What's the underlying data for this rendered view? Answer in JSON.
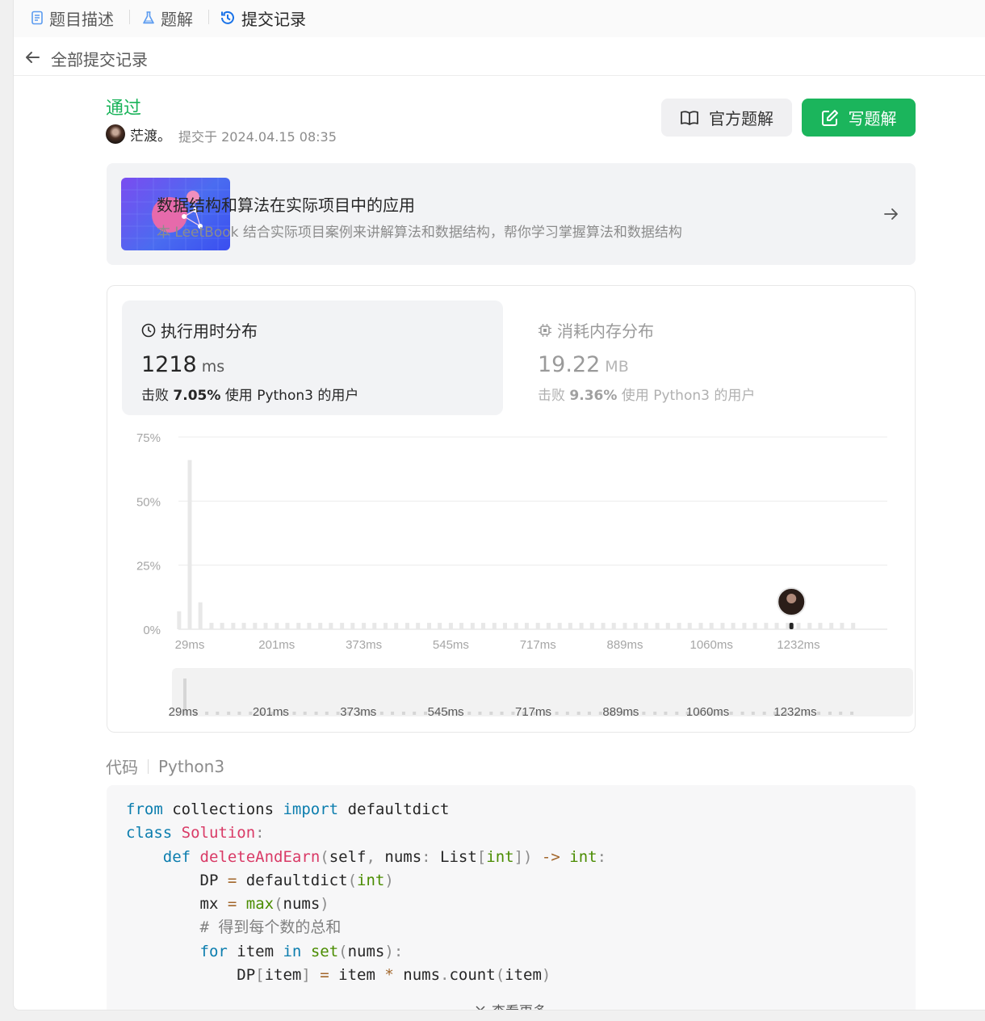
{
  "tabs": [
    {
      "label": "题目描述",
      "icon": "document-icon"
    },
    {
      "label": "题解",
      "icon": "flask-icon"
    },
    {
      "label": "提交记录",
      "icon": "history-icon",
      "active": true
    }
  ],
  "header": {
    "back_label": "全部提交记录"
  },
  "submission": {
    "status": "通过",
    "author": "茫渡。",
    "submitted": "提交于 2024.04.15 08:35",
    "official_button": "官方题解",
    "write_button": "写题解"
  },
  "banner": {
    "title": "数据结构和算法在实际项目中的应用",
    "desc": "本 LeetBook 结合实际项目案例来讲解算法和数据结构，帮你学习掌握算法和数据结构"
  },
  "runtime": {
    "label": "执行用时分布",
    "value": "1218",
    "unit": "ms",
    "beat_prefix": "击败",
    "beat_pct": "7.05%",
    "beat_suffix": "使用 Python3 的用户"
  },
  "memory": {
    "label": "消耗内存分布",
    "value": "19.22",
    "unit": "MB",
    "beat_prefix": "击败",
    "beat_pct": "9.36%",
    "beat_suffix": "使用 Python3 的用户"
  },
  "chart_data": {
    "type": "bar",
    "title": "",
    "xlabel": "",
    "ylabel": "",
    "y_ticks": [
      "75%",
      "50%",
      "25%",
      "0%"
    ],
    "ylim": [
      0,
      75
    ],
    "x_ticks": [
      "29ms",
      "201ms",
      "373ms",
      "545ms",
      "717ms",
      "889ms",
      "1060ms",
      "1232ms"
    ],
    "categories_ms": [
      8,
      29,
      50,
      72,
      93,
      115,
      136,
      158,
      179,
      201,
      222,
      244,
      265,
      287,
      308,
      330,
      351,
      373,
      394,
      416,
      437,
      459,
      480,
      502,
      523,
      545,
      566,
      588,
      609,
      631,
      652,
      674,
      695,
      717,
      738,
      760,
      781,
      803,
      824,
      846,
      867,
      889,
      910,
      931,
      953,
      974,
      996,
      1017,
      1039,
      1060,
      1082,
      1103,
      1125,
      1146,
      1168,
      1189,
      1211,
      1232,
      1254,
      1275,
      1297,
      1318,
      1340
    ],
    "values": [
      7,
      66,
      10.5,
      2.5,
      2.5,
      2.5,
      2.5,
      2.5,
      2.5,
      2.5,
      2.5,
      2.5,
      2.5,
      2.5,
      2.5,
      2.5,
      2.5,
      2.5,
      2.5,
      2.5,
      2.5,
      2.5,
      2.5,
      2.5,
      2.5,
      2.5,
      2.5,
      2.5,
      2.5,
      2.5,
      2.5,
      2.5,
      2.5,
      2.5,
      2.5,
      2.5,
      2.5,
      2.5,
      2.5,
      2.5,
      2.5,
      2.5,
      2.5,
      2.5,
      2.5,
      2.5,
      2.5,
      2.5,
      2.5,
      2.5,
      2.5,
      2.5,
      2.5,
      2.5,
      2.5,
      2.5,
      2.5,
      2.5,
      2.5,
      2.5,
      2.5,
      2.5,
      2.5
    ],
    "highlight_ms": 1218,
    "grid": true,
    "overview_ticks": [
      "29ms",
      "201ms",
      "373ms",
      "545ms",
      "717ms",
      "889ms",
      "1060ms",
      "1232ms"
    ]
  },
  "code": {
    "label": "代码",
    "lang": "Python3",
    "more": "查看更多"
  },
  "colors": {
    "accent": "#1bb55c",
    "status": "#1ab35a",
    "bar": "#e8e8e8",
    "highlight": "#262626"
  }
}
